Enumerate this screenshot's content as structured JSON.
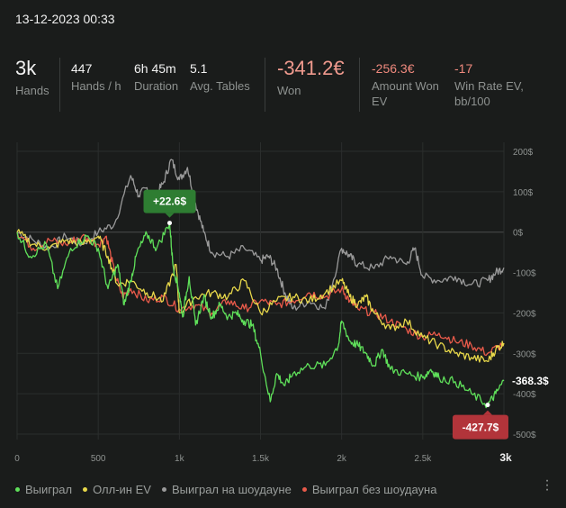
{
  "header": {
    "datetime": "13-12-2023 00:33"
  },
  "stats": [
    {
      "value": "3k",
      "label": "Hands"
    },
    {
      "value": "447",
      "label": "Hands / h"
    },
    {
      "value": "6h 45m",
      "label": "Duration"
    },
    {
      "value": "5.1",
      "label": "Avg. Tables"
    },
    {
      "value": "-341.2€",
      "label": "Won"
    },
    {
      "value": "-256.3€",
      "label": "Amount Won EV"
    },
    {
      "value": "-17",
      "label": "Win Rate EV, bb/100"
    }
  ],
  "colors": {
    "won": "#5fe05a",
    "allin_ev": "#e8d84a",
    "showdown": "#9a9a9a",
    "non_showdown": "#e85a4a",
    "max_badge": "#2e7d32",
    "min_badge": "#b2343a"
  },
  "chart_data": {
    "type": "line",
    "x_ticks": [
      "0",
      "500",
      "1k",
      "1.5k",
      "2k",
      "2.5k",
      "3k"
    ],
    "y_ticks": [
      "200$",
      "100$",
      "0$",
      "-100$",
      "-200$",
      "-300$",
      "-400$",
      "-500$"
    ],
    "xlim": [
      0,
      3000
    ],
    "ylim": [
      -500,
      200
    ],
    "grid": true,
    "annotations": {
      "max": {
        "label": "+22.6$",
        "x": 940,
        "y": 22.6
      },
      "min": {
        "label": "-427.7$",
        "x": 2900,
        "y": -427.7
      },
      "end": {
        "label": "-368.3$",
        "x": 3000,
        "y": -368.3
      }
    },
    "legend": [
      "Выиграл",
      "Олл-ин EV",
      "Выиграл на шоудауне",
      "Выиграл без шоудауна"
    ],
    "series": [
      {
        "name": "Выиграл",
        "color_key": "won",
        "points": [
          [
            0,
            0
          ],
          [
            80,
            -60
          ],
          [
            180,
            -30
          ],
          [
            250,
            -140
          ],
          [
            330,
            -40
          ],
          [
            430,
            -10
          ],
          [
            500,
            -40
          ],
          [
            560,
            -140
          ],
          [
            620,
            -80
          ],
          [
            660,
            -180
          ],
          [
            700,
            -120
          ],
          [
            740,
            -50
          ],
          [
            800,
            -5
          ],
          [
            860,
            -40
          ],
          [
            940,
            22.6
          ],
          [
            960,
            -80
          ],
          [
            1000,
            -150
          ],
          [
            1020,
            -210
          ],
          [
            1060,
            -110
          ],
          [
            1100,
            -230
          ],
          [
            1150,
            -160
          ],
          [
            1200,
            -210
          ],
          [
            1250,
            -180
          ],
          [
            1300,
            -210
          ],
          [
            1350,
            -200
          ],
          [
            1400,
            -220
          ],
          [
            1450,
            -230
          ],
          [
            1500,
            -300
          ],
          [
            1560,
            -420
          ],
          [
            1600,
            -350
          ],
          [
            1650,
            -380
          ],
          [
            1700,
            -350
          ],
          [
            1800,
            -330
          ],
          [
            1900,
            -330
          ],
          [
            1980,
            -280
          ],
          [
            2000,
            -220
          ],
          [
            2050,
            -270
          ],
          [
            2100,
            -280
          ],
          [
            2150,
            -300
          ],
          [
            2200,
            -330
          ],
          [
            2250,
            -290
          ],
          [
            2300,
            -340
          ],
          [
            2400,
            -350
          ],
          [
            2500,
            -360
          ],
          [
            2550,
            -340
          ],
          [
            2600,
            -360
          ],
          [
            2700,
            -370
          ],
          [
            2800,
            -400
          ],
          [
            2900,
            -427.7
          ],
          [
            2950,
            -400
          ],
          [
            3000,
            -368.3
          ]
        ]
      },
      {
        "name": "Олл-ин EV",
        "color_key": "allin_ev",
        "points": [
          [
            0,
            0
          ],
          [
            100,
            -30
          ],
          [
            200,
            -40
          ],
          [
            300,
            -20
          ],
          [
            400,
            -30
          ],
          [
            500,
            -10
          ],
          [
            560,
            -60
          ],
          [
            620,
            -130
          ],
          [
            700,
            -120
          ],
          [
            800,
            -150
          ],
          [
            900,
            -170
          ],
          [
            980,
            -80
          ],
          [
            1000,
            -200
          ],
          [
            1100,
            -160
          ],
          [
            1200,
            -150
          ],
          [
            1300,
            -160
          ],
          [
            1400,
            -120
          ],
          [
            1500,
            -200
          ],
          [
            1600,
            -170
          ],
          [
            1700,
            -160
          ],
          [
            1800,
            -170
          ],
          [
            1900,
            -150
          ],
          [
            2000,
            -120
          ],
          [
            2050,
            -160
          ],
          [
            2100,
            -180
          ],
          [
            2150,
            -160
          ],
          [
            2200,
            -200
          ],
          [
            2300,
            -240
          ],
          [
            2400,
            -220
          ],
          [
            2500,
            -260
          ],
          [
            2600,
            -280
          ],
          [
            2700,
            -300
          ],
          [
            2800,
            -310
          ],
          [
            2900,
            -320
          ],
          [
            2950,
            -290
          ],
          [
            3000,
            -275
          ]
        ]
      },
      {
        "name": "Выиграл на шоудауне",
        "color_key": "showdown",
        "points": [
          [
            0,
            0
          ],
          [
            100,
            -20
          ],
          [
            200,
            -40
          ],
          [
            300,
            -10
          ],
          [
            400,
            -30
          ],
          [
            500,
            0
          ],
          [
            600,
            20
          ],
          [
            700,
            140
          ],
          [
            750,
            90
          ],
          [
            800,
            110
          ],
          [
            850,
            90
          ],
          [
            900,
            120
          ],
          [
            950,
            180
          ],
          [
            1000,
            130
          ],
          [
            1050,
            160
          ],
          [
            1100,
            70
          ],
          [
            1150,
            0
          ],
          [
            1200,
            -50
          ],
          [
            1300,
            -60
          ],
          [
            1400,
            -40
          ],
          [
            1500,
            -70
          ],
          [
            1550,
            -60
          ],
          [
            1600,
            -90
          ],
          [
            1650,
            -150
          ],
          [
            1700,
            -190
          ],
          [
            1800,
            -170
          ],
          [
            1900,
            -190
          ],
          [
            2000,
            -40
          ],
          [
            2050,
            -60
          ],
          [
            2100,
            -80
          ],
          [
            2200,
            -90
          ],
          [
            2300,
            -60
          ],
          [
            2400,
            -80
          ],
          [
            2450,
            -40
          ],
          [
            2500,
            -110
          ],
          [
            2600,
            -120
          ],
          [
            2700,
            -110
          ],
          [
            2800,
            -130
          ],
          [
            2900,
            -120
          ],
          [
            2950,
            -100
          ],
          [
            3000,
            -88
          ]
        ]
      },
      {
        "name": "Выиграл без шоудауна",
        "color_key": "non_showdown",
        "points": [
          [
            0,
            0
          ],
          [
            100,
            -40
          ],
          [
            200,
            -20
          ],
          [
            300,
            -30
          ],
          [
            400,
            -10
          ],
          [
            500,
            -30
          ],
          [
            550,
            -10
          ],
          [
            600,
            -100
          ],
          [
            650,
            -160
          ],
          [
            700,
            -140
          ],
          [
            800,
            -170
          ],
          [
            900,
            -160
          ],
          [
            1000,
            -190
          ],
          [
            1100,
            -180
          ],
          [
            1200,
            -200
          ],
          [
            1300,
            -170
          ],
          [
            1400,
            -190
          ],
          [
            1500,
            -170
          ],
          [
            1600,
            -180
          ],
          [
            1700,
            -170
          ],
          [
            1800,
            -150
          ],
          [
            1900,
            -160
          ],
          [
            2000,
            -140
          ],
          [
            2050,
            -170
          ],
          [
            2100,
            -190
          ],
          [
            2200,
            -200
          ],
          [
            2300,
            -220
          ],
          [
            2400,
            -240
          ],
          [
            2500,
            -260
          ],
          [
            2600,
            -250
          ],
          [
            2700,
            -270
          ],
          [
            2800,
            -280
          ],
          [
            2900,
            -300
          ],
          [
            3000,
            -275
          ]
        ]
      }
    ]
  }
}
